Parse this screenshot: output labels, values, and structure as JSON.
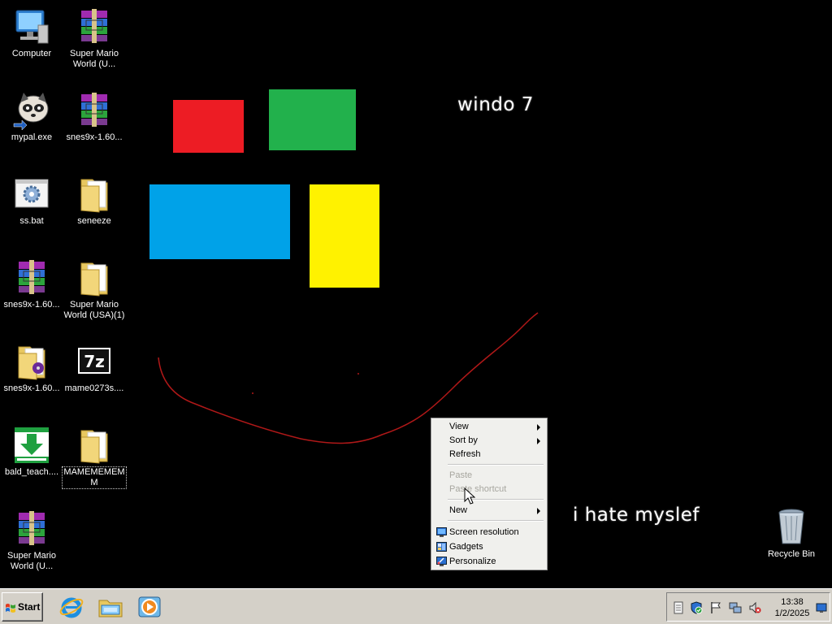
{
  "desktop": {
    "wallpaper": {
      "title_text": "windo 7",
      "caption_text": "i hate myslef",
      "colors": {
        "red": "#ed1c24",
        "green": "#22b14c",
        "blue": "#00a2e8",
        "yellow": "#fff200",
        "smile": "#b01818"
      }
    },
    "icons": [
      {
        "label": "Computer",
        "icon": "computer-icon"
      },
      {
        "label": "Super Mario World (U...",
        "icon": "winrar-archive-icon"
      },
      {
        "label": "mypal.exe",
        "icon": "raccoon-app-icon"
      },
      {
        "label": "snes9x-1.60...",
        "icon": "winrar-archive-icon"
      },
      {
        "label": "ss.bat",
        "icon": "batch-file-gear-icon"
      },
      {
        "label": "seneeze",
        "icon": "folder-icon"
      },
      {
        "label": "snes9x-1.60...",
        "icon": "winrar-archive-icon"
      },
      {
        "label": "Super Mario World (USA)(1)",
        "icon": "folder-icon"
      },
      {
        "label": "snes9x-1.60...",
        "icon": "folder-icon"
      },
      {
        "label": "mame0273s....",
        "icon": "7zip-archive-icon"
      },
      {
        "label": "bald_teach....",
        "icon": "installer-download-icon"
      },
      {
        "label": "MAMEMEMEMM",
        "icon": "folder-icon"
      },
      {
        "label": "Super Mario World (U...",
        "icon": "winrar-archive-icon"
      }
    ],
    "recycle_bin": {
      "label": "Recycle Bin",
      "icon": "recycle-bin-icon"
    }
  },
  "context_menu": {
    "items": [
      {
        "label": "View",
        "submenu": true,
        "enabled": true
      },
      {
        "label": "Sort by",
        "submenu": true,
        "enabled": true
      },
      {
        "label": "Refresh",
        "submenu": false,
        "enabled": true
      },
      {
        "label": "Paste",
        "submenu": false,
        "enabled": false
      },
      {
        "label": "Paste shortcut",
        "submenu": false,
        "enabled": false
      },
      {
        "label": "New",
        "submenu": true,
        "enabled": true
      },
      {
        "label": "Screen resolution",
        "submenu": false,
        "enabled": true,
        "icon": "screen-resolution-icon"
      },
      {
        "label": "Gadgets",
        "submenu": false,
        "enabled": true,
        "icon": "gadgets-icon"
      },
      {
        "label": "Personalize",
        "submenu": false,
        "enabled": true,
        "icon": "personalize-icon"
      }
    ]
  },
  "taskbar": {
    "start_label": "Start",
    "quick_launch": [
      {
        "icon": "internet-explorer-icon"
      },
      {
        "icon": "file-explorer-icon"
      },
      {
        "icon": "media-player-icon"
      }
    ],
    "tray": {
      "icons": [
        "action-center-icon",
        "security-shield-icon",
        "flag-icon",
        "network-icon",
        "volume-muted-icon"
      ],
      "time": "13:38",
      "date": "1/2/2025"
    }
  }
}
